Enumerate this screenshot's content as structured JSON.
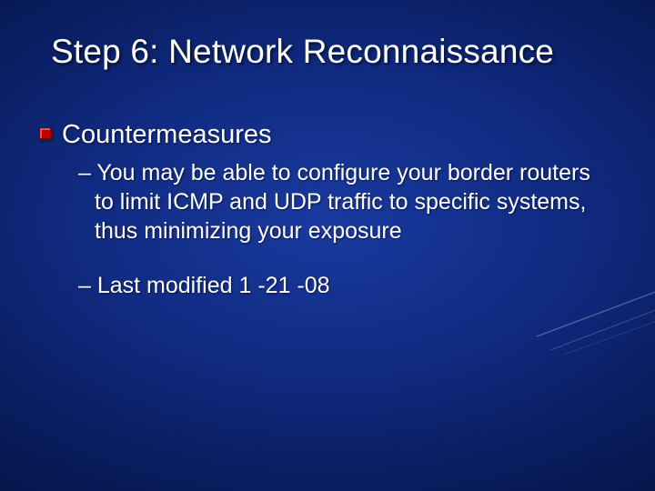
{
  "slide": {
    "title": "Step 6: Network Reconnaissance",
    "bullet1": "Countermeasures",
    "sub1": "– You may be able to configure your border routers to limit ICMP and UDP traffic to specific systems, thus minimizing your exposure",
    "sub2": "– Last modified 1 -21 -08"
  }
}
